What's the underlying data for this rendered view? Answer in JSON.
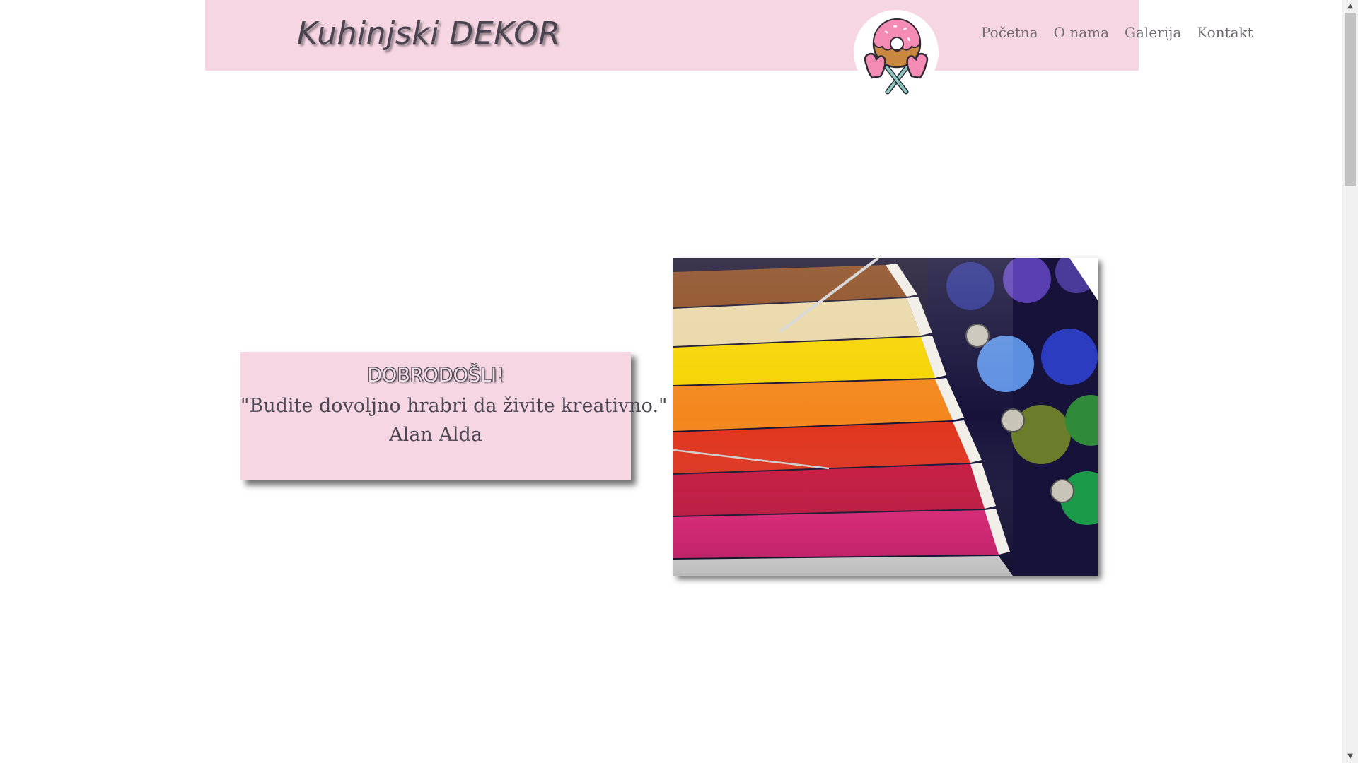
{
  "header": {
    "brand": "Kuhinjski DEKOR",
    "logo_icon": "donut-oven-mitts-icon",
    "nav": [
      {
        "label": "Početna"
      },
      {
        "label": "O nama"
      },
      {
        "label": "Galerija"
      },
      {
        "label": "Kontakt"
      }
    ]
  },
  "welcome": {
    "title": "DOBRODOŠLI!",
    "quote": "\"Budite dovoljno hrabri da živite kreativno.\"",
    "author": "Alan Alda"
  },
  "hero_image": {
    "subject": "colorful-thread-spools-image",
    "thread_colors": [
      "#8a4a1e",
      "#e9d7a6",
      "#f5d400",
      "#f3871d",
      "#e0331c",
      "#c8163f",
      "#e6247a",
      "#eeeeee"
    ]
  },
  "colors": {
    "header_bg": "#f6d6e2",
    "text": "#4b4752",
    "nav_text": "#6f6a70"
  }
}
